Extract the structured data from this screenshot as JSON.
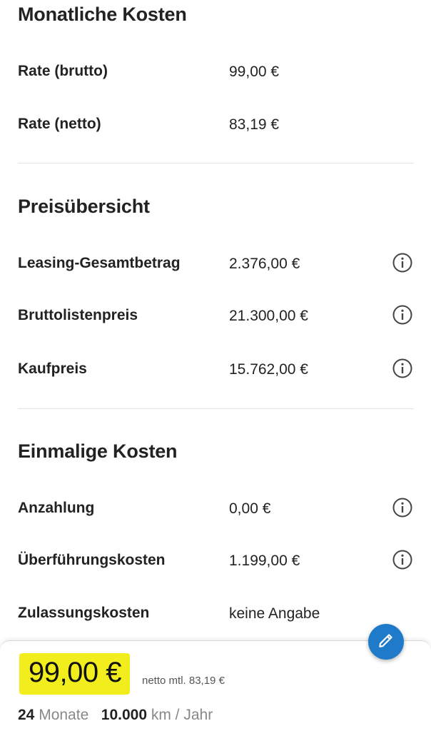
{
  "monthly": {
    "title": "Monatliche Kosten",
    "rows": [
      {
        "label": "Rate (brutto)",
        "value": "99,00 €"
      },
      {
        "label": "Rate (netto)",
        "value": "83,19 €"
      }
    ]
  },
  "overview": {
    "title": "Preisübersicht",
    "rows": [
      {
        "label": "Leasing-Gesamtbetrag",
        "value": "2.376,00 €"
      },
      {
        "label": "Bruttolistenpreis",
        "value": "21.300,00 €"
      },
      {
        "label": "Kaufpreis",
        "value": "15.762,00 €"
      }
    ]
  },
  "onetime": {
    "title": "Einmalige Kosten",
    "rows": [
      {
        "label": "Anzahlung",
        "value": "0,00 €"
      },
      {
        "label": "Überführungskosten",
        "value": "1.199,00 €"
      },
      {
        "label": "Zulassungskosten",
        "value": "keine Angabe"
      }
    ]
  },
  "bottom": {
    "price": "99,00 €",
    "netto": "netto mtl. 83,19 €",
    "months_value": "24",
    "months_unit": "Monate",
    "km_value": "10.000",
    "km_unit": "km / Jahr"
  },
  "icons": {
    "info": "info-circle-icon",
    "edit": "pencil-icon"
  },
  "colors": {
    "highlight": "#f2ee1d",
    "fab": "#1f7ac9",
    "text": "#222222",
    "muted": "#888888"
  }
}
